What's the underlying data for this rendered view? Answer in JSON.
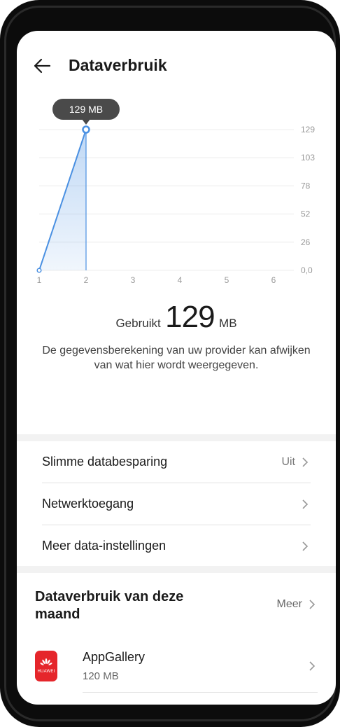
{
  "header": {
    "title": "Dataverbruik"
  },
  "chart_data": {
    "type": "area",
    "x": [
      1,
      2
    ],
    "y": [
      0,
      129
    ],
    "xticks": [
      "1",
      "2",
      "3",
      "4",
      "5",
      "6"
    ],
    "yticks": [
      "0,0",
      "26",
      "52",
      "78",
      "103",
      "129"
    ],
    "yrange": [
      0,
      129
    ],
    "tooltip": "129 MB",
    "accent": "#4a90e2"
  },
  "usage": {
    "label": "Gebruikt",
    "value": "129",
    "unit": "MB"
  },
  "note": "De gegevensberekening van uw provider kan afwijken van wat hier wordt weergegeven.",
  "settings": [
    {
      "label": "Slimme databesparing",
      "value": "Uit"
    },
    {
      "label": "Netwerktoegang",
      "value": ""
    },
    {
      "label": "Meer data-instellingen",
      "value": ""
    }
  ],
  "month": {
    "title": "Dataverbruik van deze maand",
    "more": "Meer",
    "apps": [
      {
        "name": "AppGallery",
        "size": "120 MB",
        "icon_text": "HUAWEI"
      }
    ]
  }
}
